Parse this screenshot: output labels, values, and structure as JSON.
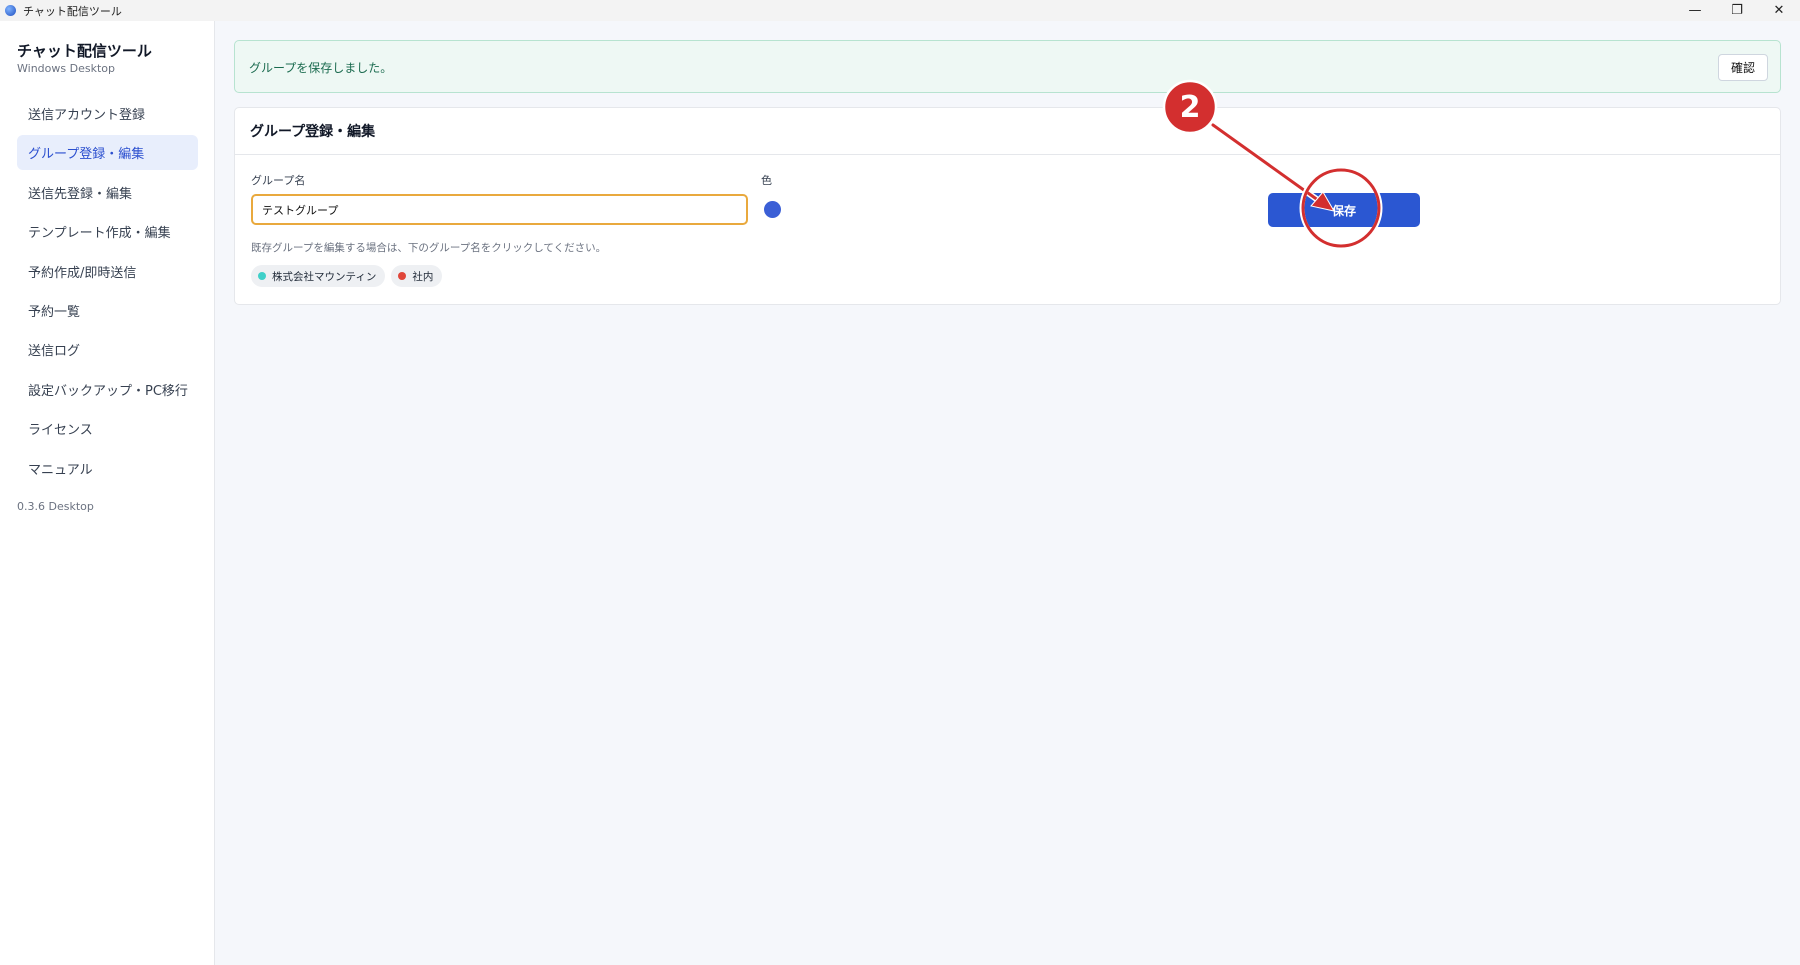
{
  "window": {
    "title": "チャット配信ツール",
    "controls": {
      "minimize": "—",
      "restore": "❐",
      "close": "✕"
    }
  },
  "sidebar": {
    "brand_title": "チャット配信ツール",
    "brand_subtitle": "Windows Desktop",
    "items": [
      {
        "label": "送信アカウント登録",
        "active": false
      },
      {
        "label": "グループ登録・編集",
        "active": true
      },
      {
        "label": "送信先登録・編集",
        "active": false
      },
      {
        "label": "テンプレート作成・編集",
        "active": false
      },
      {
        "label": "予約作成/即時送信",
        "active": false
      },
      {
        "label": "予約一覧",
        "active": false
      },
      {
        "label": "送信ログ",
        "active": false
      },
      {
        "label": "設定バックアップ・PC移行",
        "active": false
      },
      {
        "label": "ライセンス",
        "active": false
      },
      {
        "label": "マニュアル",
        "active": false
      }
    ],
    "version": "0.3.6 Desktop"
  },
  "notice": {
    "message": "グループを保存しました。",
    "confirm_label": "確認"
  },
  "card": {
    "title": "グループ登録・編集",
    "name_label": "グループ名",
    "name_value": "テストグループ",
    "color_label": "色",
    "selected_color": "#3b5fd6",
    "save_label": "保存",
    "hint": "既存グループを編集する場合は、下のグループ名をクリックしてください。",
    "groups": [
      {
        "name": "株式会社マウンティン",
        "color": "#3fd0c9"
      },
      {
        "name": "社内",
        "color": "#e0463a"
      }
    ]
  },
  "annotation": {
    "step_number": "2",
    "color": "#d32f2f"
  }
}
